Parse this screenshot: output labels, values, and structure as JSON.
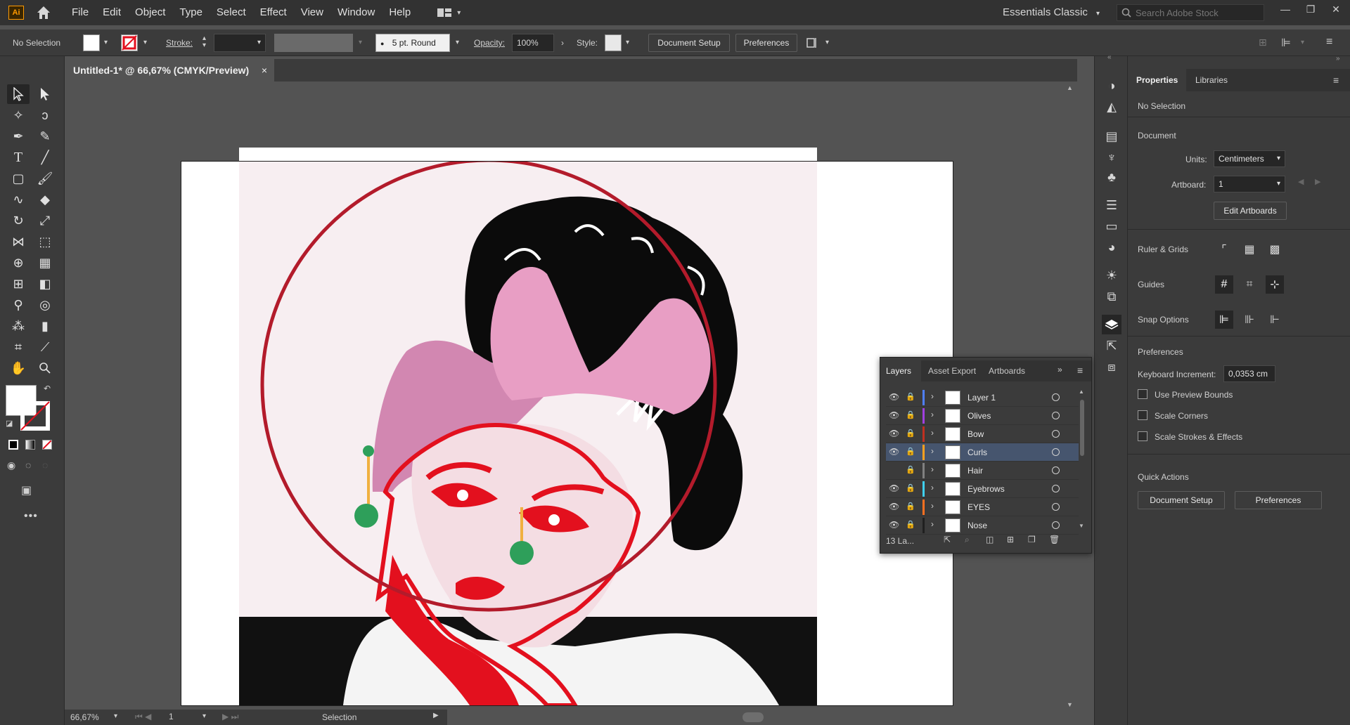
{
  "menubar": {
    "app_logo": "Ai",
    "items": [
      "File",
      "Edit",
      "Object",
      "Type",
      "Select",
      "Effect",
      "View",
      "Window",
      "Help"
    ],
    "workspace": "Essentials Classic",
    "search_placeholder": "Search Adobe Stock"
  },
  "controlbar": {
    "selection_label": "No Selection",
    "stroke_label": "Stroke:",
    "brush_value": "5 pt. Round",
    "opacity_label": "Opacity:",
    "opacity_value": "100%",
    "style_label": "Style:",
    "document_setup": "Document Setup",
    "preferences": "Preferences"
  },
  "document": {
    "tab_title": "Untitled-1* @ 66,67% (CMYK/Preview)",
    "close": "×"
  },
  "statusbar": {
    "zoom": "66,67%",
    "artboard_num": "1",
    "tool_status": "Selection"
  },
  "properties": {
    "tabs": [
      "Properties",
      "Libraries"
    ],
    "selection": "No Selection",
    "document_heading": "Document",
    "units_label": "Units:",
    "units_value": "Centimeters",
    "artboard_label": "Artboard:",
    "artboard_value": "1",
    "edit_artboards": "Edit Artboards",
    "ruler_grids": "Ruler & Grids",
    "guides": "Guides",
    "snap_options": "Snap Options",
    "preferences_heading": "Preferences",
    "keyboard_increment_label": "Keyboard Increment:",
    "keyboard_increment_value": "0,0353 cm",
    "checks": [
      "Use Preview Bounds",
      "Scale Corners",
      "Scale Strokes & Effects"
    ],
    "quick_actions": "Quick Actions",
    "qa_document_setup": "Document Setup",
    "qa_preferences": "Preferences"
  },
  "layers_panel": {
    "tabs": [
      "Layers",
      "Asset Export",
      "Artboards"
    ],
    "count": "13 La...",
    "layers": [
      {
        "name": "Layer 1",
        "color": "#4f7fff",
        "visible": true,
        "selected": false
      },
      {
        "name": "Olives",
        "color": "#a040e0",
        "visible": true,
        "selected": false
      },
      {
        "name": "Bow",
        "color": "#c03020",
        "visible": true,
        "selected": false
      },
      {
        "name": "Curls",
        "color": "#ffa020",
        "visible": true,
        "selected": true
      },
      {
        "name": "Hair",
        "color": "#808080",
        "visible": false,
        "selected": false
      },
      {
        "name": "Eyebrows",
        "color": "#40d0f0",
        "visible": true,
        "selected": false
      },
      {
        "name": "EYES",
        "color": "#ff7020",
        "visible": true,
        "selected": false
      },
      {
        "name": "Nose",
        "color": "#202020",
        "visible": true,
        "selected": false
      }
    ]
  },
  "colors": {
    "circle_red": "#b31b2b",
    "lip_red": "#e3101e",
    "bow_pink": "#e89ec4",
    "bow_dark_pink": "#d287b1",
    "earring_green": "#2e9f5a",
    "earring_gold": "#f0b040"
  }
}
